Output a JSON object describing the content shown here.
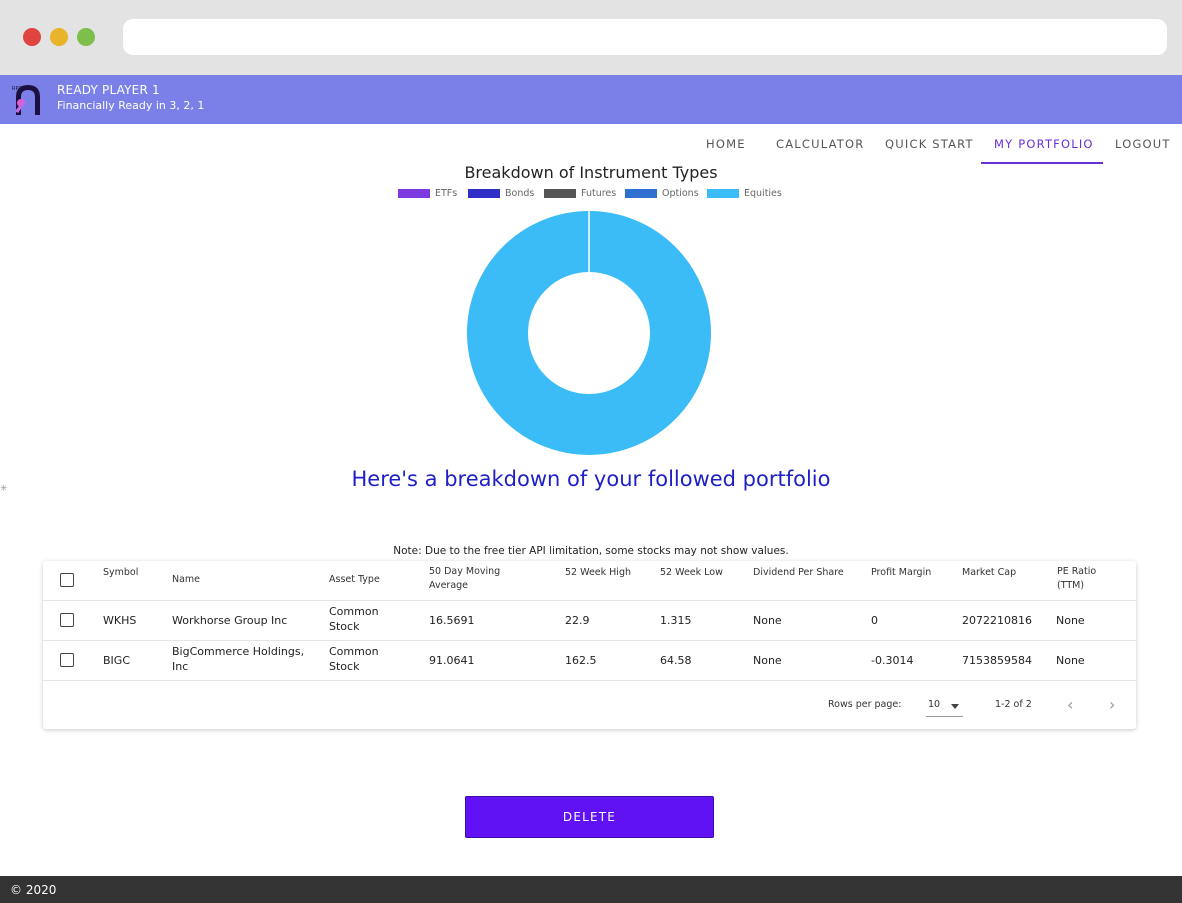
{
  "app": {
    "title": "READY PLAYER 1",
    "subtitle": "Financially Ready in 3, 2, 1"
  },
  "nav": {
    "items": [
      {
        "label": "HOME",
        "active": false
      },
      {
        "label": "CALCULATOR",
        "active": false
      },
      {
        "label": "QUICK START",
        "active": false
      },
      {
        "label": "MY PORTFOLIO",
        "active": true
      },
      {
        "label": "LOGOUT",
        "active": false
      }
    ]
  },
  "chart_data": {
    "type": "pie",
    "title": "Breakdown of Instrument Types",
    "categories": [
      "ETFs",
      "Bonds",
      "Futures",
      "Options",
      "Equities"
    ],
    "values": [
      0,
      0,
      0,
      0,
      2
    ],
    "colors": [
      "#7c3ae0",
      "#2f2ec6",
      "#555555",
      "#2f6fd0",
      "#3bbcf6"
    ],
    "legend": "top",
    "donut": true
  },
  "headline": "Here's a breakdown of your followed portfolio",
  "note": "Note: Due to the free tier API limitation, some stocks may not show values.",
  "table": {
    "headers": {
      "symbol": "Symbol",
      "name": "Name",
      "asset_type": "Asset Type",
      "ma50_line1": "50 Day Moving",
      "ma50_line2": "Average",
      "high52": "52 Week High",
      "low52": "52 Week Low",
      "dividend": "Dividend Per Share",
      "profit_margin": "Profit Margin",
      "market_cap": "Market Cap",
      "pe_line1": "PE Ratio",
      "pe_line2": "(TTM)"
    },
    "rows": [
      {
        "symbol": "WKHS",
        "name_line1": "Workhorse Group Inc",
        "name_line2": "",
        "asset_line1": "Common",
        "asset_line2": "Stock",
        "ma50": "16.5691",
        "high52": "22.9",
        "low52": "1.315",
        "dividend": "None",
        "profit_margin": "0",
        "market_cap": "2072210816",
        "pe": "None"
      },
      {
        "symbol": "BIGC",
        "name_line1": "BigCommerce Holdings,",
        "name_line2": "Inc",
        "asset_line1": "Common",
        "asset_line2": "Stock",
        "ma50": "91.0641",
        "high52": "162.5",
        "low52": "64.58",
        "dividend": "None",
        "profit_margin": "-0.3014",
        "market_cap": "7153859584",
        "pe": "None"
      }
    ],
    "footer": {
      "rows_per_page_label": "Rows per page:",
      "rows_per_page_value": "10",
      "range": "1-2 of 2",
      "prev_glyph": "‹",
      "next_glyph": "›"
    }
  },
  "delete_label": "DELETE",
  "copyright": "© 2020",
  "colors": {
    "appbar": "#7b80e8",
    "accent": "#6a2fd6",
    "delete_button": "#6112f5",
    "headline": "#1f1fc8"
  }
}
